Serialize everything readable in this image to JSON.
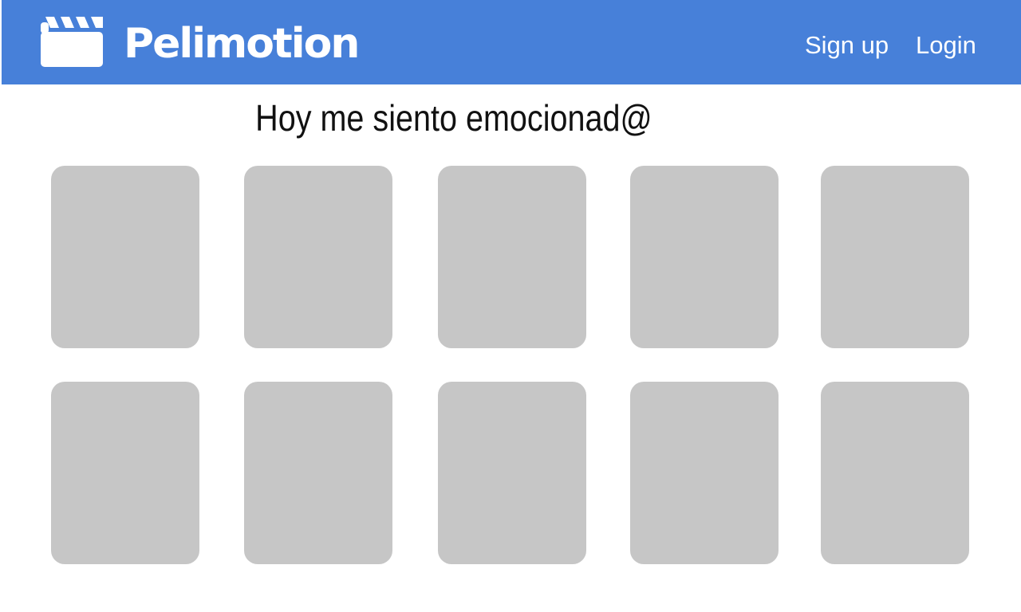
{
  "header": {
    "brand": "Pelimotion",
    "logo_icon": "clapperboard-icon",
    "background_color": "#4780d9",
    "nav": {
      "signup_label": "Sign up",
      "login_label": "Login"
    }
  },
  "main": {
    "heading": "Hoy me siento emocionad@",
    "card_color": "#c6c6c6",
    "rows": [
      {
        "cards": [
          {},
          {},
          {},
          {},
          {}
        ]
      },
      {
        "cards": [
          {},
          {},
          {},
          {},
          {}
        ]
      }
    ]
  }
}
